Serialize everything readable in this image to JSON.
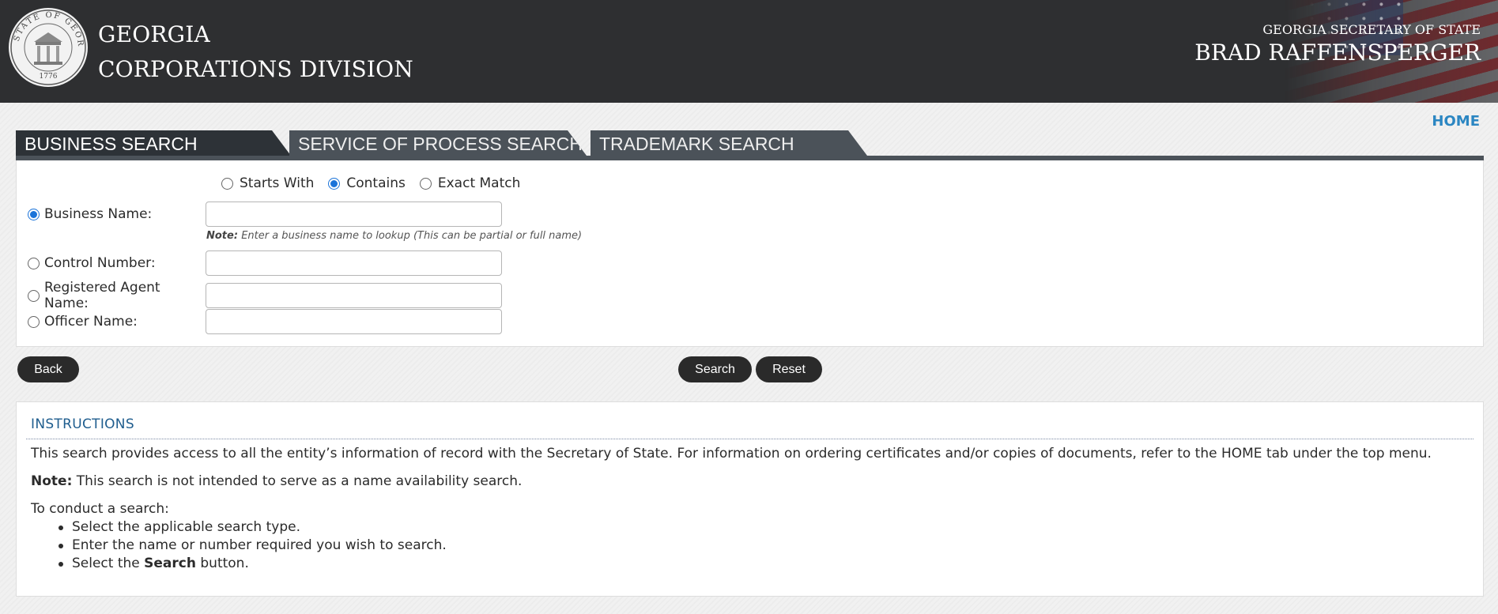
{
  "header": {
    "seal_text": "STATE OF GEORGIA",
    "seal_year": "1776",
    "title_line1": "GEORGIA",
    "title_line2": "CORPORATIONS DIVISION",
    "sos_line1": "GEORGIA SECRETARY OF STATE",
    "sos_line2": "BRAD RAFFENSPERGER"
  },
  "nav": {
    "home": "HOME"
  },
  "tabs": [
    {
      "label": "BUSINESS SEARCH",
      "active": true
    },
    {
      "label": "SERVICE OF PROCESS SEARCH",
      "active": false
    },
    {
      "label": "TRADEMARK SEARCH",
      "active": false
    }
  ],
  "search": {
    "match_options": [
      {
        "label": "Starts With",
        "checked": false
      },
      {
        "label": "Contains",
        "checked": true
      },
      {
        "label": "Exact Match",
        "checked": false
      }
    ],
    "fields": [
      {
        "label": "Business Name:",
        "value": "",
        "checked": true
      },
      {
        "label": "Control Number:",
        "value": "",
        "checked": false
      },
      {
        "label": "Registered Agent Name:",
        "value": "",
        "checked": false
      },
      {
        "label": "Officer Name:",
        "value": "",
        "checked": false
      }
    ],
    "note_label": "Note:",
    "note_text": "Enter a business name to lookup (This can be partial or full name)"
  },
  "buttons": {
    "back": "Back",
    "search": "Search",
    "reset": "Reset"
  },
  "instructions": {
    "title": "INSTRUCTIONS",
    "intro": "This search provides access to all the entity’s information of record with the Secretary of State. For information on ordering certificates and/or copies of documents, refer to the HOME tab under the top menu.",
    "note_label": "Note:",
    "note_text": "This search is not intended to serve as a name availability search.",
    "conduct": "To conduct a search:",
    "steps": [
      "Select the applicable search type.",
      "Enter the name or number required you wish to search."
    ],
    "step3_prefix": "Select the ",
    "step3_bold": "Search",
    "step3_suffix": " button."
  },
  "colors": {
    "header_bg": "#2e2f31",
    "tab_active": "#2d3237",
    "tab_inactive": "#4b5259",
    "link": "#2b86c2",
    "radio_checked": "#1a73d9",
    "button_bg": "#2a2a2a",
    "instructions_title": "#1f5d8e"
  },
  "icons": {
    "seal": "state-seal-icon",
    "flag": "american-flag-decoration"
  }
}
